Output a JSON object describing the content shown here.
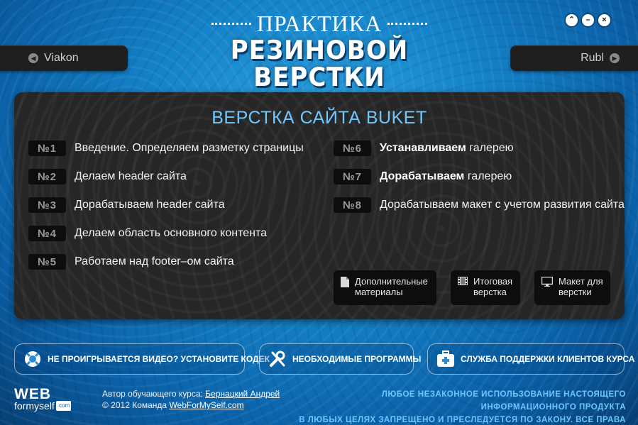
{
  "window_controls": {
    "up_glyph": "⌃",
    "minimize_glyph": "–",
    "close_glyph": "×"
  },
  "logo": {
    "line1": "ПРАКТИКА",
    "line2": "РЕЗИНОВОЙ",
    "line3": "ВЕРСТКИ"
  },
  "nav": {
    "prev_label": "Viakon",
    "prev_icon": "chevron-left-icon",
    "next_label": "Rubl",
    "next_icon": "chevron-right-icon"
  },
  "panel": {
    "title": "ВЕРСТКА САЙТА BUKET",
    "lessons_left": [
      {
        "num": "№1",
        "text": "Введение. Определяем разметку страницы"
      },
      {
        "num": "№2",
        "text": "Делаем header сайта"
      },
      {
        "num": "№3",
        "text": "Дорабатываем header сайта"
      },
      {
        "num": "№4",
        "text": "Делаем область основного контента"
      },
      {
        "num": "№5",
        "text": "Работаем над footer–ом сайта"
      }
    ],
    "lessons_right": [
      {
        "num": "№6",
        "bold": "Устанавливаем",
        "text": " галерею"
      },
      {
        "num": "№7",
        "bold": "Дорабатываем",
        "text": " галерею"
      },
      {
        "num": "№8",
        "bold": "",
        "text": "Дорабатываем макет с учетом развития сайта"
      }
    ],
    "materials": [
      {
        "label1": "Дополнительные",
        "label2": "материалы",
        "icon": "document-icon"
      },
      {
        "label1": "Итоговая",
        "label2": "верстка",
        "icon": "film-icon"
      },
      {
        "label1": "Макет для",
        "label2": "верстки",
        "icon": "monitor-icon"
      }
    ]
  },
  "bottom_buttons": [
    {
      "label": "НЕ ПРОИГРЫВАЕТСЯ ВИДЕО? УСТАНОВИТЕ КОДЕК",
      "icon": "lifebuoy-icon"
    },
    {
      "label": "НЕОБХОДИМЫЕ ПРОГРАММЫ",
      "icon": "tools-icon"
    },
    {
      "label": "СЛУЖБА ПОДДЕРЖКИ КЛИЕНТОВ КУРСА",
      "icon": "first-aid-kit-icon"
    }
  ],
  "footer": {
    "logo_web": "WEB",
    "logo_sub": "formyself",
    "logo_com": ".com",
    "author_prefix": "Автор обучающего курса: ",
    "author_name": "Бернацкий Андрей",
    "copyright_prefix": "© 2012 Команда ",
    "copyright_link": "WebForMySelf.com",
    "legal_line1": "Любое незаконное использование настоящего информационного продукта",
    "legal_line2": "в любых целях запрещено и преследуется по закону. Все права защищены"
  }
}
